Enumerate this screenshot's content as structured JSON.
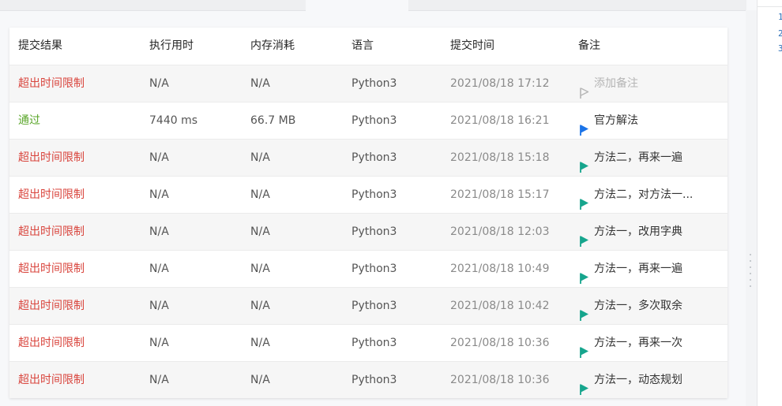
{
  "table": {
    "columns": [
      "提交结果",
      "执行用时",
      "内存消耗",
      "语言",
      "提交时间",
      "备注"
    ],
    "rows": [
      {
        "status": "超出时间限制",
        "status_type": "tle",
        "time": "N/A",
        "memory": "N/A",
        "language": "Python3",
        "date": "2021/08/18 17:12",
        "note": "添加备注",
        "note_type": "empty",
        "flag": "outline-gray-flag"
      },
      {
        "status": "通过",
        "status_type": "accepted",
        "time": "7440 ms",
        "memory": "66.7 MB",
        "language": "Python3",
        "date": "2021/08/18 16:21",
        "note": "官方解法",
        "note_type": "set",
        "flag": "blue-flag"
      },
      {
        "status": "超出时间限制",
        "status_type": "tle",
        "time": "N/A",
        "memory": "N/A",
        "language": "Python3",
        "date": "2021/08/18 15:18",
        "note": "方法二，再来一遍",
        "note_type": "set",
        "flag": "teal-flag"
      },
      {
        "status": "超出时间限制",
        "status_type": "tle",
        "time": "N/A",
        "memory": "N/A",
        "language": "Python3",
        "date": "2021/08/18 15:17",
        "note": "方法二，对方法一...",
        "note_type": "set",
        "flag": "teal-flag"
      },
      {
        "status": "超出时间限制",
        "status_type": "tle",
        "time": "N/A",
        "memory": "N/A",
        "language": "Python3",
        "date": "2021/08/18 12:03",
        "note": "方法一，改用字典",
        "note_type": "set",
        "flag": "teal-flag"
      },
      {
        "status": "超出时间限制",
        "status_type": "tle",
        "time": "N/A",
        "memory": "N/A",
        "language": "Python3",
        "date": "2021/08/18 10:49",
        "note": "方法一，再来一遍",
        "note_type": "set",
        "flag": "teal-flag"
      },
      {
        "status": "超出时间限制",
        "status_type": "tle",
        "time": "N/A",
        "memory": "N/A",
        "language": "Python3",
        "date": "2021/08/18 10:42",
        "note": "方法一，多次取余",
        "note_type": "set",
        "flag": "teal-flag"
      },
      {
        "status": "超出时间限制",
        "status_type": "tle",
        "time": "N/A",
        "memory": "N/A",
        "language": "Python3",
        "date": "2021/08/18 10:36",
        "note": "方法一，再来一次",
        "note_type": "set",
        "flag": "teal-flag"
      },
      {
        "status": "超出时间限制",
        "status_type": "tle",
        "time": "N/A",
        "memory": "N/A",
        "language": "Python3",
        "date": "2021/08/18 10:36",
        "note": "方法一，动态规划",
        "note_type": "set",
        "flag": "teal-flag"
      }
    ]
  },
  "editor": {
    "line_numbers": [
      "1",
      "2",
      "3"
    ]
  },
  "colors": {
    "tle": "#d9453d",
    "accepted": "#5aa62a",
    "blue_flag": "#1a73e8",
    "teal_flag": "#16a58d",
    "gray_flag": "#b5b5b5"
  }
}
